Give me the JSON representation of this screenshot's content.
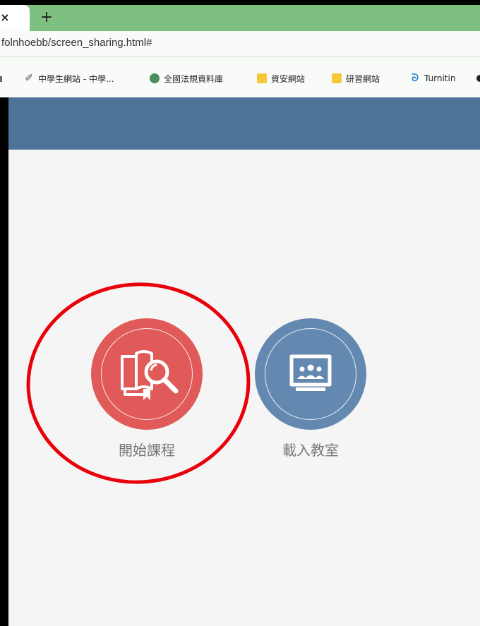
{
  "browser": {
    "tab": {
      "close_glyph": "×"
    },
    "new_tab_glyph": "+",
    "address": "folnhoebb/screen_sharing.html#",
    "bookmarks": [
      {
        "label": "中學生網站 - 中學...",
        "icon": "paperclip-icon"
      },
      {
        "label": "全國法規資料庫",
        "icon": "globe-icon"
      },
      {
        "label": "資安網站",
        "icon": "folder-icon"
      },
      {
        "label": "研習網站",
        "icon": "folder-icon"
      },
      {
        "label": "Turnitin",
        "icon": "turnitin-icon"
      }
    ]
  },
  "actions": [
    {
      "label": "開始課程",
      "icon": "book-search-icon",
      "color": "#e05a5a"
    },
    {
      "label": "載入教室",
      "icon": "classroom-icon",
      "color": "#6489b1"
    }
  ],
  "annotation": {
    "color": "#e8000b"
  },
  "colors": {
    "tabstrip": "#7fbf7f",
    "header": "#4e7399",
    "content_bg": "#f5f5f5"
  }
}
